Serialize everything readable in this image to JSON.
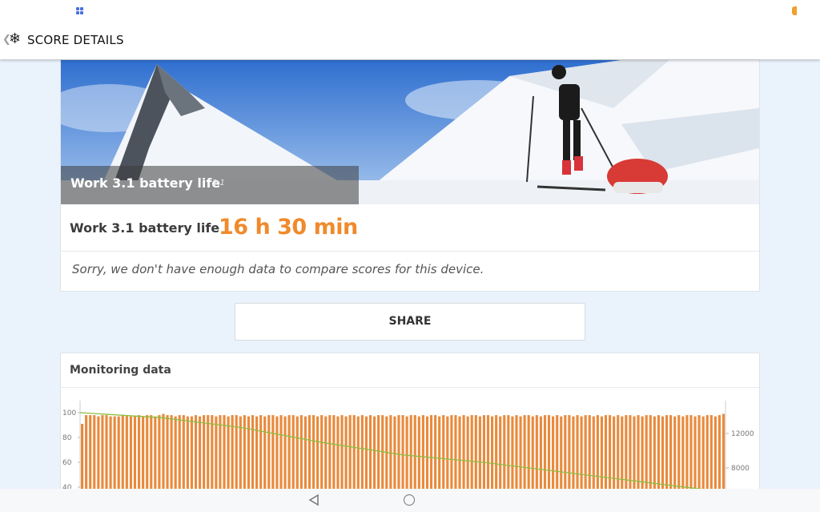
{
  "appbar": {
    "title": "SCORE DETAILS",
    "back_icon": "chevron-left-icon",
    "logo_icon": "snowflake-icon"
  },
  "hero": {
    "title": "Work 3.1 battery life",
    "version": "3.1"
  },
  "score": {
    "label": "Work 3.1 battery life",
    "value": "16 h 30 min",
    "value_color": "#f08a2c"
  },
  "compare": {
    "message": "Sorry, we don't have enough data to compare scores for this device."
  },
  "share": {
    "label": "SHARE"
  },
  "monitoring": {
    "title": "Monitoring data"
  },
  "chart_data": {
    "type": "bar",
    "left_axis_ticks": [
      "100",
      "80",
      "60",
      "40"
    ],
    "right_axis_ticks": [
      "12000",
      "8000"
    ],
    "left_ylim": [
      40,
      100
    ],
    "series": [
      {
        "type": "bar",
        "color": "#e98a3c",
        "values": [
          91,
          98,
          98,
          98,
          97,
          98,
          98,
          97,
          97,
          97,
          98,
          98,
          97,
          97,
          98,
          97,
          98,
          98,
          97,
          98,
          99,
          98,
          98,
          97,
          98,
          98,
          97,
          97,
          98,
          97,
          98,
          98,
          98,
          97,
          98,
          98,
          97,
          98,
          98,
          97,
          98,
          97,
          98,
          97,
          98,
          97,
          98,
          98,
          97,
          98,
          97,
          98,
          98,
          97,
          98,
          97,
          98,
          98,
          97,
          98,
          97,
          98,
          98,
          97,
          98,
          97,
          98,
          98,
          97,
          98,
          97,
          98,
          97,
          98,
          98,
          97,
          98,
          97,
          98,
          98,
          97,
          98,
          98,
          97,
          98,
          97,
          98,
          98,
          97,
          98,
          97,
          98,
          98,
          97,
          98,
          97,
          98,
          98,
          97,
          98,
          98,
          97,
          98,
          97,
          98,
          98,
          97,
          98,
          97,
          98,
          98,
          97,
          98,
          97,
          98,
          98,
          97,
          98,
          97,
          98,
          98,
          97,
          98,
          97,
          98,
          98,
          97,
          98,
          97,
          98,
          98,
          97,
          98,
          97,
          98,
          98,
          97,
          98,
          97,
          98,
          98,
          97,
          98,
          97,
          98,
          98,
          97,
          98,
          97,
          98,
          98,
          97,
          98,
          97,
          98,
          98,
          97,
          98,
          99
        ]
      },
      {
        "type": "line",
        "color": "#8cbf3f",
        "values": [
          100,
          96,
          88,
          76,
          66,
          60,
          52,
          44,
          36
        ]
      }
    ]
  },
  "statusbar": {
    "apps_icon": "apps-grid-icon",
    "battery_icon": "battery-icon"
  },
  "navbar": {
    "back_icon": "nav-back-icon",
    "home_icon": "nav-home-icon"
  }
}
